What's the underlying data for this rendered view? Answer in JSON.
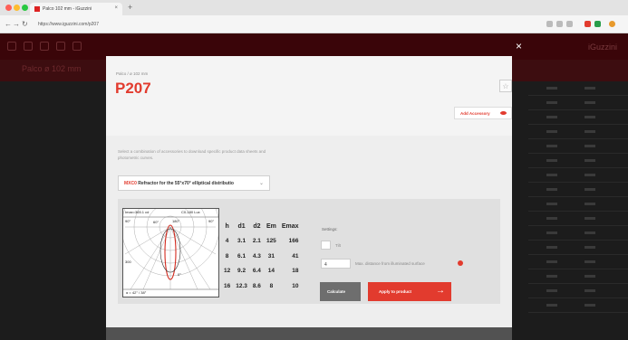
{
  "browser": {
    "tab_title": "Palco 102 mm - iGuzzini",
    "url": "https://www.iguzzini.com/p207",
    "traffic_colors": [
      "#ff5f57",
      "#febc2e",
      "#28c840"
    ]
  },
  "site": {
    "brand": "iGuzzini",
    "page_heading": "Palco ø 102 mm",
    "accent": "#e23b2e"
  },
  "modal": {
    "close_symbol": "×",
    "breadcrumb": "Palco / ø 102 mm",
    "title": "P207",
    "star_symbol": "☆",
    "add_accessory_label": "Add Accessory",
    "helper_text": "Select a combination of accessories to download specific product data sheets and photometric curves.",
    "select": {
      "code": "MXC0",
      "label": "Refractor for the 55°x70° elliptical distributio",
      "chevron": "⌄"
    },
    "diagram": {
      "imax": "Imax=365.1 cd",
      "curve": "C0-180 Lux",
      "angle_left": "90°",
      "angle_right": "90°",
      "angle_top": "180°",
      "angle_small": "60°",
      "value_300": "300",
      "angle_zero": "0°",
      "beam": "α = 42° / 38°"
    },
    "table": {
      "headers": [
        "h",
        "d1",
        "d2",
        "Em",
        "Emax"
      ],
      "rows": [
        [
          "4",
          "3.1",
          "2.1",
          "125",
          "166"
        ],
        [
          "8",
          "6.1",
          "4.3",
          "31",
          "41"
        ],
        [
          "12",
          "9.2",
          "6.4",
          "14",
          "18"
        ],
        [
          "16",
          "12.3",
          "8.6",
          "8",
          "10"
        ]
      ]
    },
    "settings": {
      "title": "Settings:",
      "tilt_label": "Tilt",
      "distance_value": "4",
      "distance_label": "Max. distance from illuminated surface",
      "calculate_label": "Calculate",
      "apply_label": "Apply to product",
      "apply_arrow": "→"
    }
  }
}
